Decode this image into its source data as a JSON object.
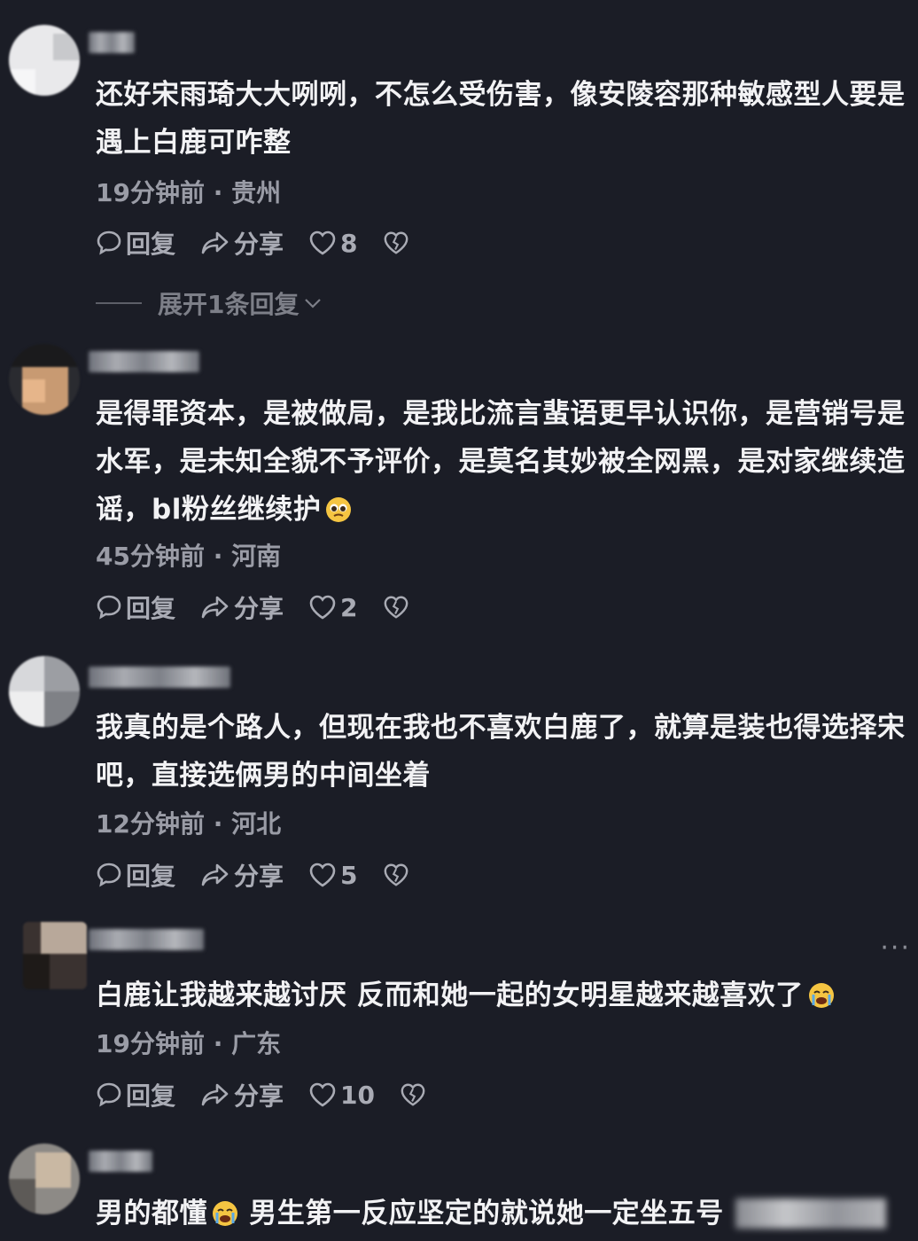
{
  "comments": [
    {
      "text": "还好宋雨琦大大咧咧，不怎么受伤害，像安陵容那种敏感型人要是遇上白鹿可咋整",
      "time": "19分钟前",
      "location": "贵州",
      "reply_label": "回复",
      "share_label": "分享",
      "likes": "8",
      "expand_label": "展开1条回复"
    },
    {
      "text": "是得罪资本，是被做局，是我比流言蜚语更早认识你，是营销号是水军，是未知全貌不予评价，是莫名其妙被全网黑，是对家继续造谣，bl粉丝继续护",
      "emoji": "pleading-face",
      "time": "45分钟前",
      "location": "河南",
      "reply_label": "回复",
      "share_label": "分享",
      "likes": "2"
    },
    {
      "text": "我真的是个路人，但现在我也不喜欢白鹿了，就算是装也得选择宋吧，直接选俩男的中间坐着",
      "time": "12分钟前",
      "location": "河北",
      "reply_label": "回复",
      "share_label": "分享",
      "likes": "5"
    },
    {
      "text": "白鹿让我越来越讨厌 反而和她一起的女明星越来越喜欢了",
      "emoji": "loudly-crying-face",
      "time": "19分钟前",
      "location": "广东",
      "reply_label": "回复",
      "share_label": "分享",
      "likes": "10",
      "more_label": "···"
    },
    {
      "text_before_emoji": "男的都懂",
      "emoji": "loudly-crying-face",
      "text_after_emoji": "男生第一反应坚定的就说她一定坐五号"
    }
  ],
  "separator": "·",
  "colors": {
    "background": "#1b1d26",
    "text": "#f2f2f4",
    "meta": "#9a9ca6",
    "action": "#a9abb4"
  },
  "icons": [
    "comment-bubble-icon",
    "share-arrow-icon",
    "heart-icon",
    "broken-heart-icon",
    "chevron-down-icon"
  ]
}
